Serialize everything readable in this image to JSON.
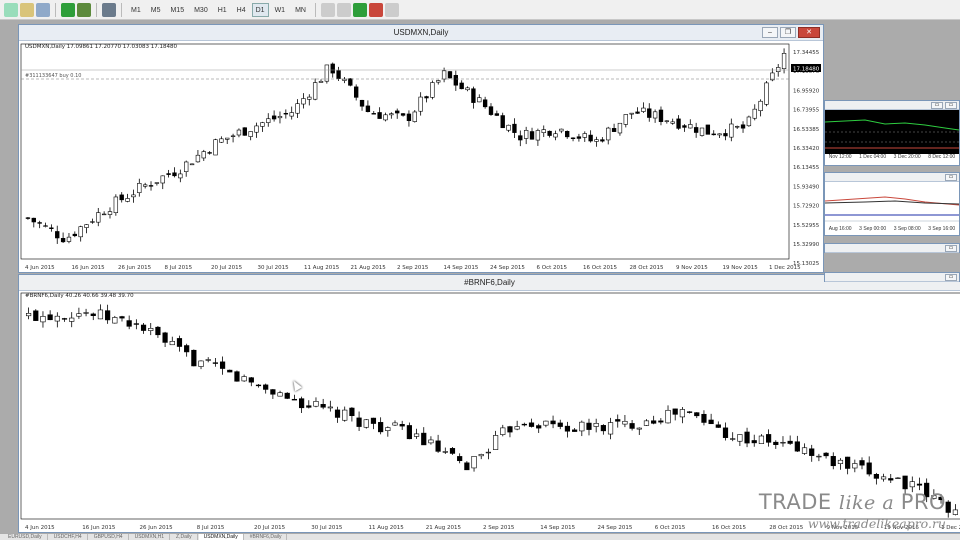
{
  "toolbar": {
    "timeframes": [
      {
        "label": "M1",
        "active": false
      },
      {
        "label": "M5",
        "active": false
      },
      {
        "label": "M15",
        "active": false
      },
      {
        "label": "M30",
        "active": false
      },
      {
        "label": "H1",
        "active": false
      },
      {
        "label": "H4",
        "active": false
      },
      {
        "label": "D1",
        "active": true
      },
      {
        "label": "W1",
        "active": false
      },
      {
        "label": "MN",
        "active": false
      }
    ]
  },
  "top_chart": {
    "title": "USDMXN,Daily",
    "info": "USDMXN,Daily  17.09861 17.20770 17.03083 17.18480",
    "order_label": "#311133647 buy 0.10",
    "current_price": "17.18480",
    "price_labels": [
      "17.34455",
      "17.15070",
      "16.95920",
      "16.73955",
      "16.53385",
      "16.33420",
      "16.13455",
      "15.93490",
      "15.72920",
      "15.52955",
      "15.32990",
      "15.13025"
    ],
    "date_labels": [
      "4 Jun 2015",
      "16 Jun 2015",
      "26 Jun 2015",
      "8 Jul 2015",
      "20 Jul 2015",
      "30 Jul 2015",
      "11 Aug 2015",
      "21 Aug 2015",
      "2 Sep 2015",
      "14 Sep 2015",
      "24 Sep 2015",
      "6 Oct 2015",
      "16 Oct 2015",
      "28 Oct 2015",
      "9 Nov 2015",
      "19 Nov 2015",
      "1 Dec 2015"
    ]
  },
  "bottom_chart": {
    "title": "#BRNF6,Daily",
    "info": "#BRNF6,Daily  40.26 40.66 39.48 39.70",
    "date_labels": [
      "4 Jun 2015",
      "16 Jun 2015",
      "26 Jun 2015",
      "8 Jul 2015",
      "20 Jul 2015",
      "30 Jul 2015",
      "11 Aug 2015",
      "21 Aug 2015",
      "2 Sep 2015",
      "14 Sep 2015",
      "24 Sep 2015",
      "6 Oct 2015",
      "16 Oct 2015",
      "28 Oct 2015",
      "9 Nov 2015",
      "19 Nov 2015",
      "1 Dec 2015"
    ]
  },
  "side_panels": {
    "panel1_dates": [
      "Nov 12:00",
      "1 Dec 04:00",
      "3 Dec 20:00",
      "8 Dec 12:00"
    ],
    "panel2_dates": [
      "Aug 16:00",
      "3 Sep 00:00",
      "3 Sep 08:00",
      "3 Sep 16:00"
    ]
  },
  "tabs": [
    "EURUSD,Daily",
    "USDCHF,H4",
    "GBPUSD,H4",
    "USDMXN,H1",
    "Z,Daily",
    "USDMXN,Daily",
    "#BRNF6,Daily"
  ],
  "watermark": {
    "brand_main": "TRADE ",
    "brand_italic": "like a ",
    "brand_end": "PRO",
    "url": "www.tradelikeapro.ru"
  },
  "colors": {
    "bull": "#ffffff",
    "bear": "#000000",
    "grid": "#c8c8c8",
    "accent_green": "#2e9e3a",
    "accent_red": "#c9473b"
  }
}
